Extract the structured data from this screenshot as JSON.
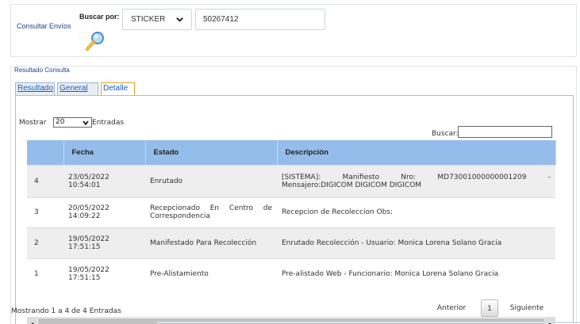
{
  "search": {
    "consult_label": "Consultar Envíos",
    "search_by_label": "Buscar por:",
    "type_selected": "STICKER",
    "query_value": "50267412"
  },
  "result": {
    "title": "Resultado Consulta",
    "tabs": [
      {
        "label": "Resultado",
        "active": false
      },
      {
        "label": "General",
        "active": false
      },
      {
        "label": "Detalle",
        "active": true
      }
    ],
    "length": {
      "prefix": "Mostrar",
      "value": "20",
      "suffix": "Entradas"
    },
    "filter_label": "Buscar:",
    "columns": [
      "",
      "Fecha",
      "Estado",
      "Descripción"
    ],
    "rows": [
      {
        "num": "4",
        "fecha": "23/05/2022 10:54:01",
        "estado": "Enrutado",
        "descripcion_line1": "[SISTEMA]:   Manifiesto   Nro:   MD73001000000001209   -",
        "descripcion_line2": "Mensajero:DIGICOM DIGICOM DIGICOM"
      },
      {
        "num": "3",
        "fecha": "20/05/2022 14:09:22",
        "estado": "Recepcionado En Centro de Correspondencia",
        "descripcion_line1": "Recepcion de Recoleccion Obs:",
        "descripcion_line2": ""
      },
      {
        "num": "2",
        "fecha": "19/05/2022 17:51:15",
        "estado": "Manifestado Para Recolección",
        "descripcion_line1": "Enrutado Recolección - Usuario: Monica Lorena Solano Gracia",
        "descripcion_line2": ""
      },
      {
        "num": "1",
        "fecha": "19/05/2022 17:51:15",
        "estado": "Pre-Alistamiento",
        "descripcion_line1": "Pre-alistado Web - Funcionario: Monica Lorena Solano Gracia",
        "descripcion_line2": ""
      }
    ],
    "info": "Mostrando 1 a 4 de 4 Entradas",
    "pager": {
      "previous": "Anterior",
      "current": "1",
      "next": "Siguiente"
    }
  },
  "colors": {
    "header_bg": "#94bdeb",
    "link_blue": "#1a5fb4",
    "title_blue": "#1f3f8f",
    "active_tab_border": "#e0a030"
  },
  "icons": [
    "search-magnifier-icon",
    "chevron-down-icon",
    "arrow-left-icon",
    "arrow-right-icon"
  ]
}
